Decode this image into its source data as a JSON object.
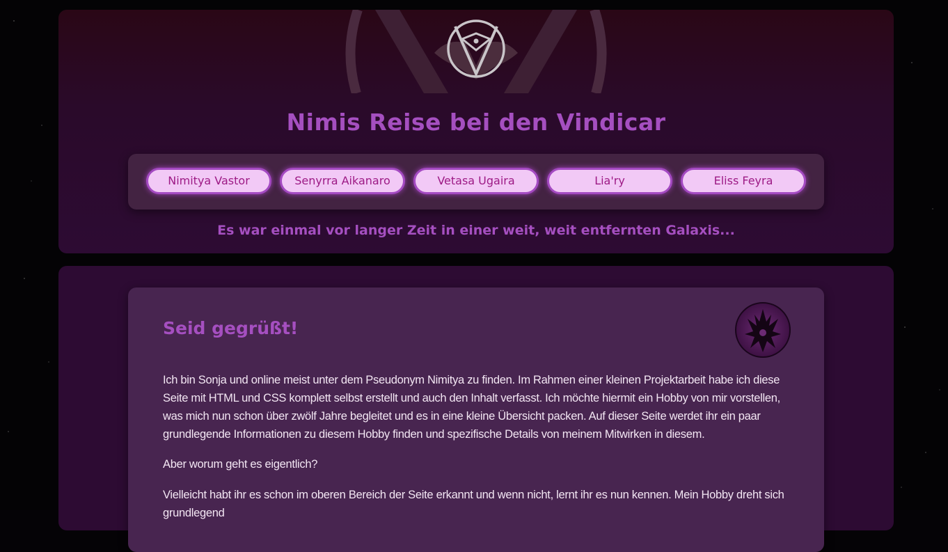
{
  "header": {
    "title": "Nimis Reise bei den Vindicar",
    "tagline": "Es war einmal vor langer Zeit in einer weit, weit entfernten Galaxis..."
  },
  "nav": {
    "items": [
      {
        "label": "Nimitya Vastor"
      },
      {
        "label": "Senyrra Aikanaro"
      },
      {
        "label": "Vetasa Ugaira"
      },
      {
        "label": "Lia'ry"
      },
      {
        "label": "Eliss Feyra"
      }
    ]
  },
  "content": {
    "heading": "Seid gegrüßt!",
    "paragraphs": [
      "Ich bin Sonja und online meist unter dem Pseudonym Nimitya zu finden. Im Rahmen einer kleinen Projektarbeit habe ich diese Seite mit HTML und CSS komplett selbst erstellt und auch den Inhalt verfasst. Ich möchte hiermit ein Hobby von mir vorstellen, was mich nun schon über zwölf Jahre begleitet und es in eine kleine Übersicht packen. Auf dieser Seite werdet ihr ein paar grundlegende Informationen zu diesem Hobby finden und spezifische Details von meinem Mitwirken in diesem.",
      "Aber worum geht es eigentlich?",
      "Vielleicht habt ihr es schon im oberen Bereich der Seite erkannt und wenn nicht, lernt ihr es nun kennen. Mein Hobby dreht sich grundlegend"
    ]
  },
  "colors": {
    "accent": "#a54fc0",
    "button_bg": "#f2c9f6",
    "button_text": "#9d1a85",
    "page_bg": "#040305"
  },
  "icons": {
    "logo": "vindicar-emblem-icon",
    "avatar": "dragon-emblem-icon"
  }
}
